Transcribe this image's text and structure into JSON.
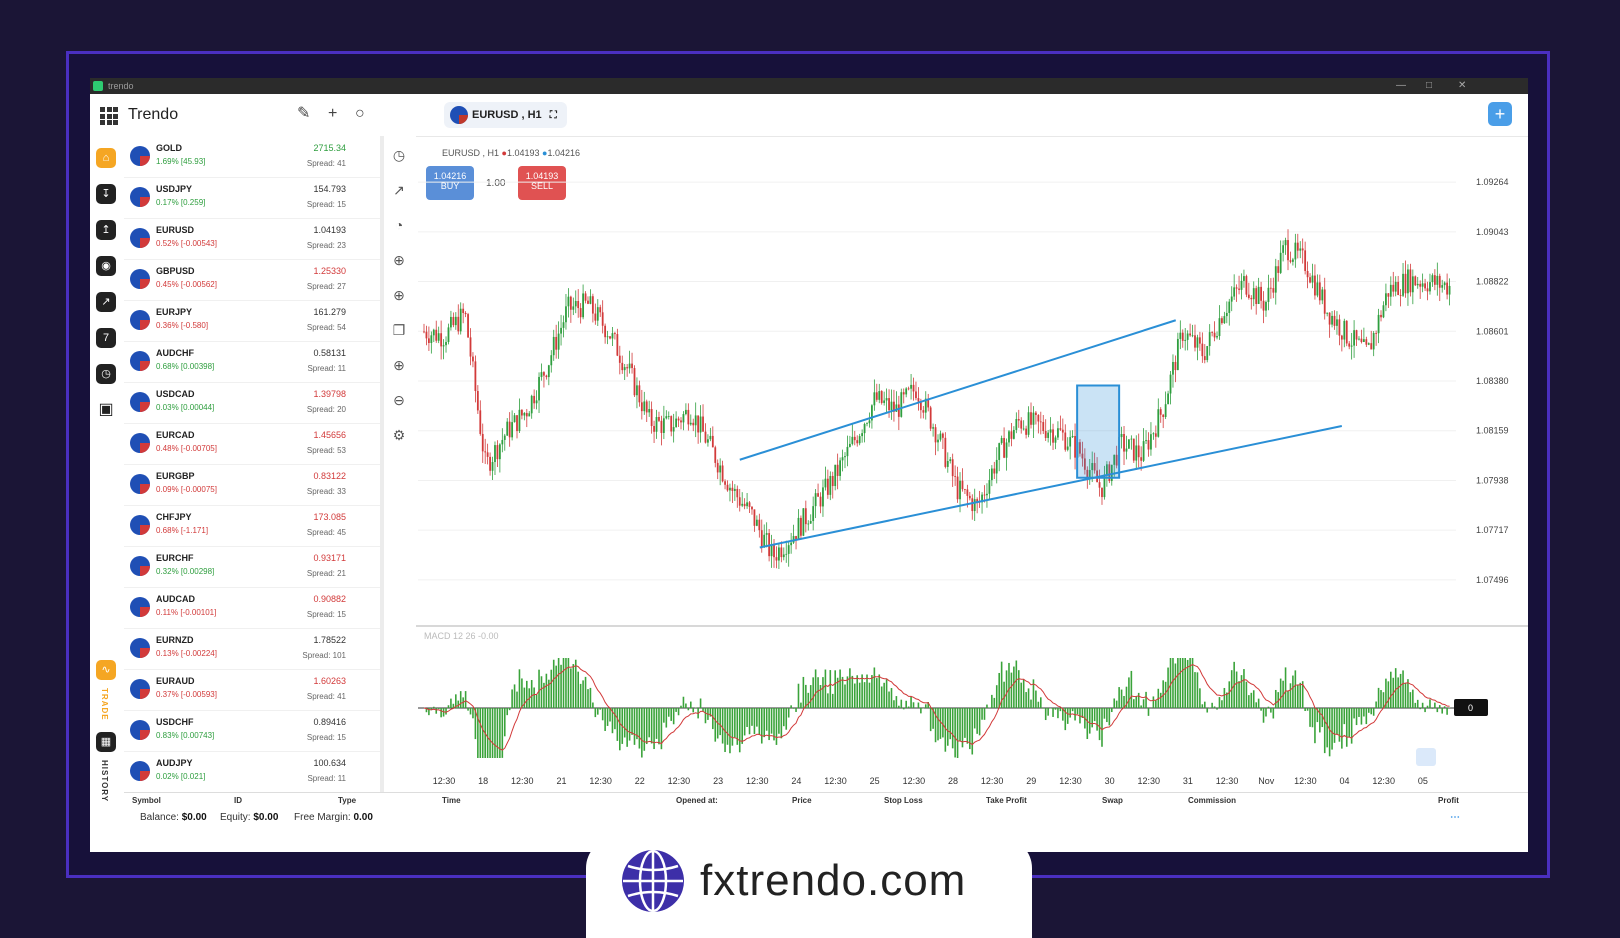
{
  "window": {
    "title": "trendo"
  },
  "header": {
    "app_title": "Trendo",
    "symbol_tab": "EURUSD , H1"
  },
  "sidebar": {
    "trade_label": "TRADE",
    "history_label": "HISTORY"
  },
  "watchlist": [
    {
      "symbol": "GOLD",
      "change": "1.69% [45.93]",
      "change_color": "#2e9e3e",
      "price": "2715.34",
      "price_color": "#2e9e3e",
      "spread": "Spread: 41"
    },
    {
      "symbol": "USDJPY",
      "change": "0.17% [0.259]",
      "change_color": "#2e9e3e",
      "price": "154.793",
      "price_color": "#333333",
      "spread": "Spread: 15"
    },
    {
      "symbol": "EURUSD",
      "change": "0.52% [-0.00543]",
      "change_color": "#d23a3a",
      "price": "1.04193",
      "price_color": "#333333",
      "spread": "Spread: 23"
    },
    {
      "symbol": "GBPUSD",
      "change": "0.45% [-0.00562]",
      "change_color": "#d23a3a",
      "price": "1.25330",
      "price_color": "#d23a3a",
      "spread": "Spread: 27"
    },
    {
      "symbol": "EURJPY",
      "change": "0.36% [-0.580]",
      "change_color": "#d23a3a",
      "price": "161.279",
      "price_color": "#333333",
      "spread": "Spread: 54"
    },
    {
      "symbol": "AUDCHF",
      "change": "0.68% [0.00398]",
      "change_color": "#2e9e3e",
      "price": "0.58131",
      "price_color": "#333333",
      "spread": "Spread: 11"
    },
    {
      "symbol": "USDCAD",
      "change": "0.03% [0.00044]",
      "change_color": "#2e9e3e",
      "price": "1.39798",
      "price_color": "#d23a3a",
      "spread": "Spread: 20"
    },
    {
      "symbol": "EURCAD",
      "change": "0.48% [-0.00705]",
      "change_color": "#d23a3a",
      "price": "1.45656",
      "price_color": "#d23a3a",
      "spread": "Spread: 53"
    },
    {
      "symbol": "EURGBP",
      "change": "0.09% [-0.00075]",
      "change_color": "#d23a3a",
      "price": "0.83122",
      "price_color": "#d23a3a",
      "spread": "Spread: 33"
    },
    {
      "symbol": "CHFJPY",
      "change": "0.68% [-1.171]",
      "change_color": "#d23a3a",
      "price": "173.085",
      "price_color": "#d23a3a",
      "spread": "Spread: 45"
    },
    {
      "symbol": "EURCHF",
      "change": "0.32% [0.00298]",
      "change_color": "#2e9e3e",
      "price": "0.93171",
      "price_color": "#d23a3a",
      "spread": "Spread: 21"
    },
    {
      "symbol": "AUDCAD",
      "change": "0.11% [-0.00101]",
      "change_color": "#d23a3a",
      "price": "0.90882",
      "price_color": "#d23a3a",
      "spread": "Spread: 15"
    },
    {
      "symbol": "EURNZD",
      "change": "0.13% [-0.00224]",
      "change_color": "#d23a3a",
      "price": "1.78522",
      "price_color": "#333333",
      "spread": "Spread: 101"
    },
    {
      "symbol": "EURAUD",
      "change": "0.37% [-0.00593]",
      "change_color": "#d23a3a",
      "price": "1.60263",
      "price_color": "#d23a3a",
      "spread": "Spread: 41"
    },
    {
      "symbol": "USDCHF",
      "change": "0.83% [0.00743]",
      "change_color": "#2e9e3e",
      "price": "0.89416",
      "price_color": "#333333",
      "spread": "Spread: 15"
    },
    {
      "symbol": "AUDJPY",
      "change": "0.02% [0.021]",
      "change_color": "#2e9e3e",
      "price": "100.634",
      "price_color": "#333333",
      "spread": "Spread: 11"
    }
  ],
  "chart_panel": {
    "legend": "EURUSD , H1",
    "legend_bid": "1.04193",
    "legend_ask": "1.04216",
    "buy_price": "1.04216",
    "buy_label": "BUY",
    "sell_price": "1.04193",
    "sell_label": "SELL",
    "quantity": "1.00",
    "macd_label": "MACD 12 26 -0.00",
    "macd_value": "0"
  },
  "chart_data": {
    "type": "candlestick",
    "y_ticks": [
      "1.09264",
      "1.09043",
      "1.08822",
      "1.08601",
      "1.08380",
      "1.08159",
      "1.07938",
      "1.07717",
      "1.07496"
    ],
    "ylim": [
      1.0738,
      1.0938
    ],
    "x_ticks": [
      "12:30",
      "18",
      "12:30",
      "21",
      "12:30",
      "22",
      "12:30",
      "23",
      "12:30",
      "24",
      "12:30",
      "25",
      "12:30",
      "28",
      "12:30",
      "29",
      "12:30",
      "30",
      "12:30",
      "31",
      "12:30",
      "Nov",
      "12:30",
      "04",
      "12:30",
      "05"
    ],
    "close_path": [
      1.086,
      1.0858,
      1.0868,
      1.08,
      1.0815,
      1.0825,
      1.0845,
      1.087,
      1.0872,
      1.086,
      1.0842,
      1.082,
      1.0818,
      1.0825,
      1.0808,
      1.079,
      1.0778,
      1.076,
      1.077,
      1.0782,
      1.0795,
      1.0812,
      1.083,
      1.0825,
      1.0835,
      1.0815,
      1.079,
      1.0782,
      1.0805,
      1.082,
      1.0818,
      1.0815,
      1.0806,
      1.079,
      1.081,
      1.0805,
      1.0825,
      1.086,
      1.085,
      1.087,
      1.0882,
      1.0872,
      1.0898,
      1.089,
      1.087,
      1.0858,
      1.085,
      1.0878,
      1.0883,
      1.0882,
      1.088
    ],
    "channel_upper": [
      [
        1.0803,
        0.0
      ],
      [
        1.0865,
        1.0
      ]
    ],
    "channel_lower": [
      [
        1.0764,
        0.0
      ],
      [
        1.0818,
        1.0
      ]
    ]
  },
  "bottom": {
    "columns": [
      "Symbol",
      "ID",
      "Type",
      "Time",
      "Opened at:",
      "Price",
      "Stop Loss",
      "Take Profit",
      "Swap",
      "Commission",
      "Profit"
    ],
    "balance_label": "Balance:",
    "balance_value": "$0.00",
    "equity_label": "Equity:",
    "equity_value": "$0.00",
    "free_margin_label": "Free Margin:",
    "free_margin_value": "0.00"
  },
  "brand": {
    "text": "fxtrendo.com"
  },
  "colors": {
    "accent": "#4a9ee8",
    "up": "#2e9e3e",
    "down": "#d23a3a",
    "line": "#2a8fd6"
  }
}
